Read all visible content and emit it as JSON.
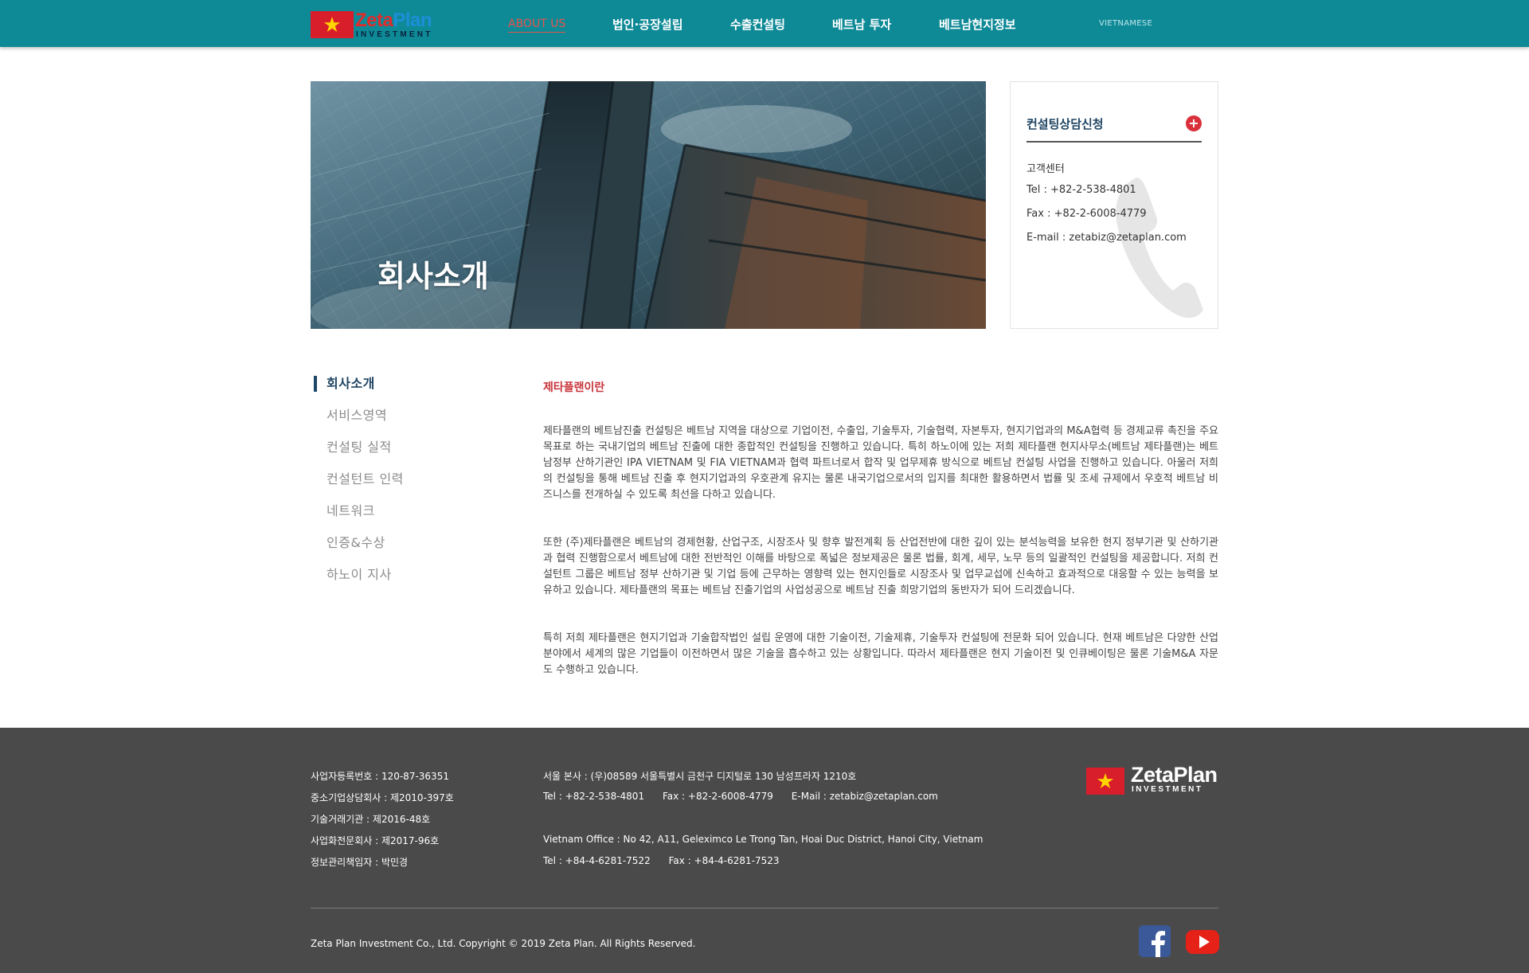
{
  "header": {
    "logo": {
      "brand_a": "Zeta",
      "brand_b": "Plan",
      "sub": "INVESTMENT"
    },
    "nav": [
      {
        "label": "ABOUT US",
        "active": true
      },
      {
        "label": "법인·공장설립"
      },
      {
        "label": "수출컨설팅"
      },
      {
        "label": "베트남 투자"
      },
      {
        "label": "베트남현지정보"
      }
    ],
    "language": "VIETNAMESE"
  },
  "hero": {
    "title": "회사소개"
  },
  "contact_box": {
    "title": "컨설팅상담신청",
    "plus_icon": "+",
    "center_label": "고객센터",
    "tel": "Tel : +82-2-538-4801",
    "fax": "Fax : +82-2-6008-4779",
    "email": "E-mail : zetabiz@zetaplan.com"
  },
  "side_menu": {
    "items": [
      {
        "label": "회사소개",
        "active": true
      },
      {
        "label": "서비스영역"
      },
      {
        "label": "컨설팅 실적"
      },
      {
        "label": "컨설턴트 인력"
      },
      {
        "label": "네트워크"
      },
      {
        "label": "인증&수상"
      },
      {
        "label": "하노이 지사"
      }
    ]
  },
  "content": {
    "section_title": "제타플랜이란",
    "paragraphs": [
      "제타플랜의 베트남진출 컨설팅은 베트남 지역을 대상으로 기업이전, 수출입, 기술투자, 기술협력, 자본투자, 현지기업과의 M&A협력 등 경제교류 촉진을 주요 목표로 하는 국내기업의 베트남 진출에 대한 종합적인 컨설팅을 진행하고 있습니다. 특히 하노이에 있는 저희 제타플랜 현지사무소(베트남 제타플랜)는 베트남정부 산하기관인 IPA VIETNAM 및 FIA VIETNAM과 협력 파트너로서 합작 및 업무제휴 방식으로 베트남 컨설팅 사업을 진행하고 있습니다. 아울러 저희의 컨설팅을 통해 베트남 진출 후 현지기업과의 우호관계 유지는 물론 내국기업으로서의 입지를 최대한 활용하면서 법률 및 조세 규제에서 우호적 베트남 비즈니스를 전개하실 수 있도록 최선을 다하고 있습니다.",
      "또한 (주)제타플랜은 베트남의 경제현황, 산업구조, 시장조사 및 향후 발전계획 등 산업전반에 대한 깊이 있는 분석능력을 보유한 현지 정부기관 및 산하기관과 협력 진행함으로서 베트남에 대한 전반적인 이해를 바탕으로 폭넓은 정보제공은 물론 법률, 회계, 세무, 노무 등의 일괄적인 컨설팅을 제공합니다. 저희 컨설턴트 그룹은 베트남 정부 산하기관 및 기업 등에 근무하는 영향력 있는 현지인들로 시장조사 및 업무교섭에 신속하고 효과적으로 대응할 수 있는 능력을 보유하고 있습니다. 제타플랜의 목표는 베트남 진출기업의 사업성공으로 베트남 진출 희망기업의 동반자가 되어 드리겠습니다.",
      "특히 저희 제타플랜은 현지기업과 기술합작법인 설립 운영에 대한 기술이전, 기술제휴, 기술투자 컨설팅에 전문화 되어 있습니다. 현재 베트남은 다양한 산업분야에서 세계의 많은 기업들이 이전하면서 많은 기술을 흡수하고 있는 상황입니다. 따라서 제타플랜은 현지 기술이전 및 인큐베이팅은 물론 기술M&A 자문도 수행하고 있습니다."
    ]
  },
  "footer": {
    "left": [
      "사업자등록번호 : 120-87-36351",
      "중소기업상담회사 : 제2010-397호",
      "기술거래기관 : 제2016-48호",
      "사업화전문회사 : 제2017-96호",
      "정보관리책임자 : 박민경"
    ],
    "seoul_address": "서울 본사 : (우)08589 서울특별시 금천구 디지털로 130 남성프라자 1210호",
    "seoul_contact": "Tel : +82-2-538-4801      Fax : +82-2-6008-4779      E-Mail : zetabiz@zetaplan.com",
    "vietnam_address": "Vietnam Office : No 42, A11, Geleximco Le Trong Tan, Hoai Duc District, Hanoi City, Vietnam",
    "vietnam_contact": "Tel : +84-4-6281-7522      Fax : +84-4-6281-7523",
    "copyright": "Zeta Plan Investment Co., Ltd. Copyright © 2019 Zeta Plan. All Rights Reserved.",
    "logo": {
      "brand": "ZetaPlan",
      "sub": "INVESTMENT"
    }
  },
  "colors": {
    "header_bg": "#0e8a97",
    "nav_active": "#e3554d",
    "accent_navy": "#1f4564",
    "section_title": "#c9343a",
    "footer_bg": "#4a4a4a",
    "flag_red": "#d81e2b",
    "facebook": "#3b5998",
    "youtube": "#e62117"
  }
}
